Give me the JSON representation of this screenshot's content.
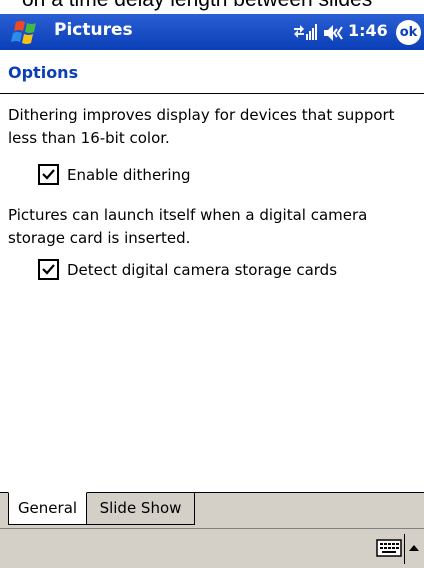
{
  "top_crop_text": "on a time delay length between slides",
  "titlebar": {
    "app_title": "Pictures",
    "time": "1:46",
    "ok_label": "ok",
    "icons": [
      "windows-start-icon",
      "connectivity-icon",
      "volume-icon"
    ]
  },
  "section": {
    "title": "Options"
  },
  "dithering": {
    "description": "Dithering improves display for devices that support less than 16-bit color.",
    "checkbox_label": "Enable dithering",
    "checked": true
  },
  "camera": {
    "description": "Pictures can launch itself when a digital camera storage card is inserted.",
    "checkbox_label": "Detect digital camera storage cards",
    "checked": true
  },
  "tabs": [
    {
      "label": "General",
      "active": true
    },
    {
      "label": "Slide Show",
      "active": false
    }
  ],
  "colors": {
    "titlebar": "#0a3fb7",
    "header_text": "#0a3fb7",
    "bar_gray": "#d4d0c8"
  },
  "bottombar": {
    "icons": [
      "keyboard-icon",
      "input-arrow-up-icon"
    ]
  }
}
